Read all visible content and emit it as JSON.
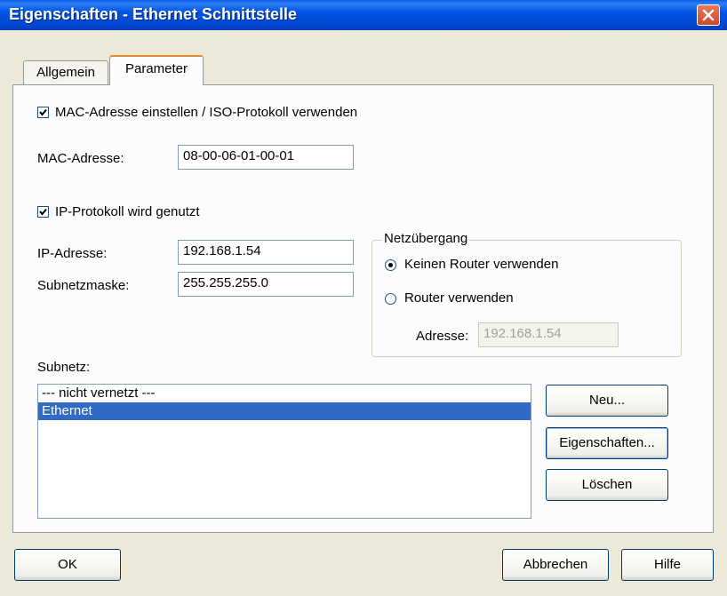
{
  "window": {
    "title": "Eigenschaften - Ethernet Schnittstelle"
  },
  "tabs": [
    {
      "label": "Allgemein"
    },
    {
      "label": "Parameter"
    }
  ],
  "parameter": {
    "mac_checkbox": {
      "label": "MAC-Adresse einstellen / ISO-Protokoll verwenden",
      "checked": true
    },
    "mac_address": {
      "label": "MAC-Adresse:",
      "value": "08-00-06-01-00-01"
    },
    "ip_checkbox": {
      "label": "IP-Protokoll wird genutzt",
      "checked": true
    },
    "ip_address": {
      "label": "IP-Adresse:",
      "value": "192.168.1.54"
    },
    "subnet_mask": {
      "label": "Subnetzmaske:",
      "value": "255.255.255.0"
    },
    "gateway": {
      "title": "Netzübergang",
      "no_router": {
        "label": "Keinen Router verwenden",
        "selected": true
      },
      "router": {
        "label": "Router verwenden",
        "selected": false
      },
      "address": {
        "label": "Adresse:",
        "value": "192.168.1.54"
      }
    },
    "subnet": {
      "label": "Subnetz:",
      "items": [
        "--- nicht vernetzt ---",
        "Ethernet"
      ],
      "selected_index": 1,
      "buttons": {
        "new": "Neu...",
        "properties": "Eigenschaften...",
        "delete": "Löschen"
      }
    }
  },
  "footer": {
    "ok": "OK",
    "cancel": "Abbrechen",
    "help": "Hilfe"
  },
  "colors": {
    "titlebar": "#0054E3",
    "selection": "#316AC5",
    "dialog": "#ECE9D8"
  }
}
